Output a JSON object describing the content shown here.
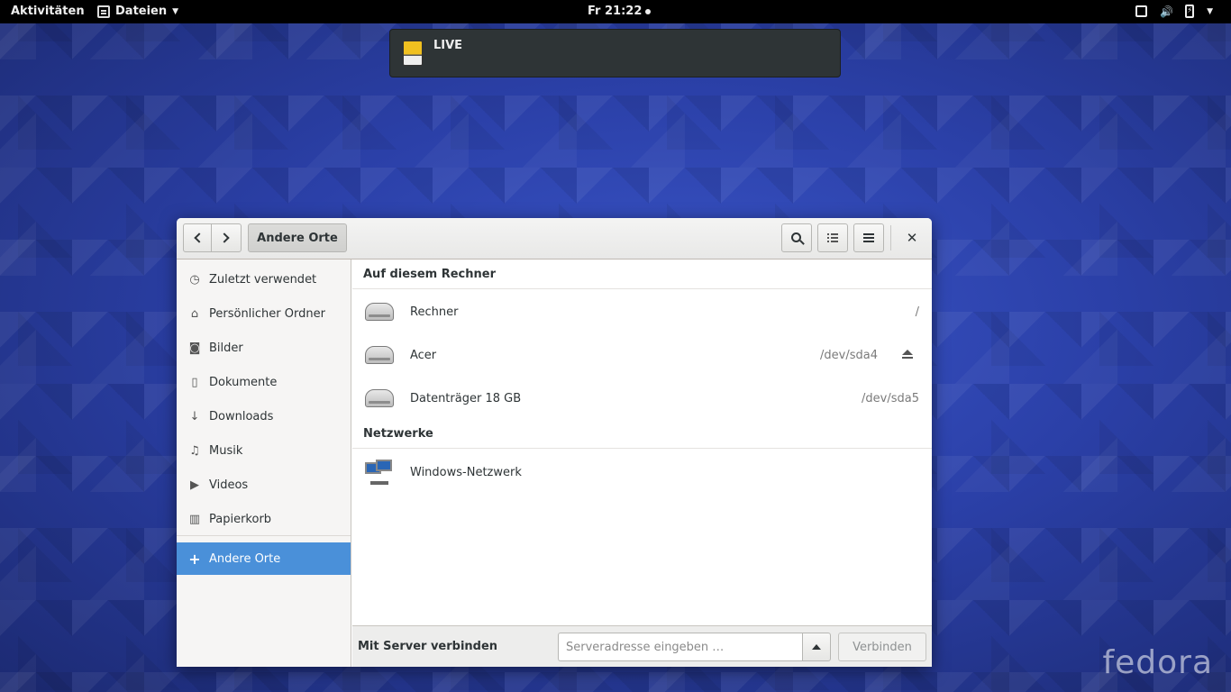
{
  "topbar": {
    "activities": "Aktivitäten",
    "app_menu": "Dateien",
    "clock": "Fr 21:22"
  },
  "notification": {
    "title": "LIVE"
  },
  "window": {
    "path_button": "Andere Orte"
  },
  "sidebar": {
    "items": [
      {
        "label": "Zuletzt verwendet",
        "icon": "clock-icon"
      },
      {
        "label": "Persönlicher Ordner",
        "icon": "home-icon"
      },
      {
        "label": "Bilder",
        "icon": "camera-icon"
      },
      {
        "label": "Dokumente",
        "icon": "document-icon"
      },
      {
        "label": "Downloads",
        "icon": "download-icon"
      },
      {
        "label": "Musik",
        "icon": "music-icon"
      },
      {
        "label": "Videos",
        "icon": "video-icon"
      },
      {
        "label": "Papierkorb",
        "icon": "trash-icon"
      }
    ],
    "other_places": "Andere Orte"
  },
  "content": {
    "section_computer": "Auf diesem Rechner",
    "places": [
      {
        "name": "Rechner",
        "path": "/"
      },
      {
        "name": "Acer",
        "path": "/dev/sda4"
      },
      {
        "name": "Datenträger 18 GB",
        "path": "/dev/sda5"
      }
    ],
    "section_networks": "Netzwerke",
    "networks": [
      {
        "name": "Windows-Netzwerk"
      }
    ]
  },
  "bottombar": {
    "label": "Mit Server verbinden",
    "placeholder": "Serveradresse eingeben …",
    "connect": "Verbinden"
  },
  "desktop": {
    "logo": "fedora"
  },
  "colors": {
    "accent": "#4a90d9",
    "topbar": "#000000",
    "wallpaper": "#2b40a8"
  }
}
